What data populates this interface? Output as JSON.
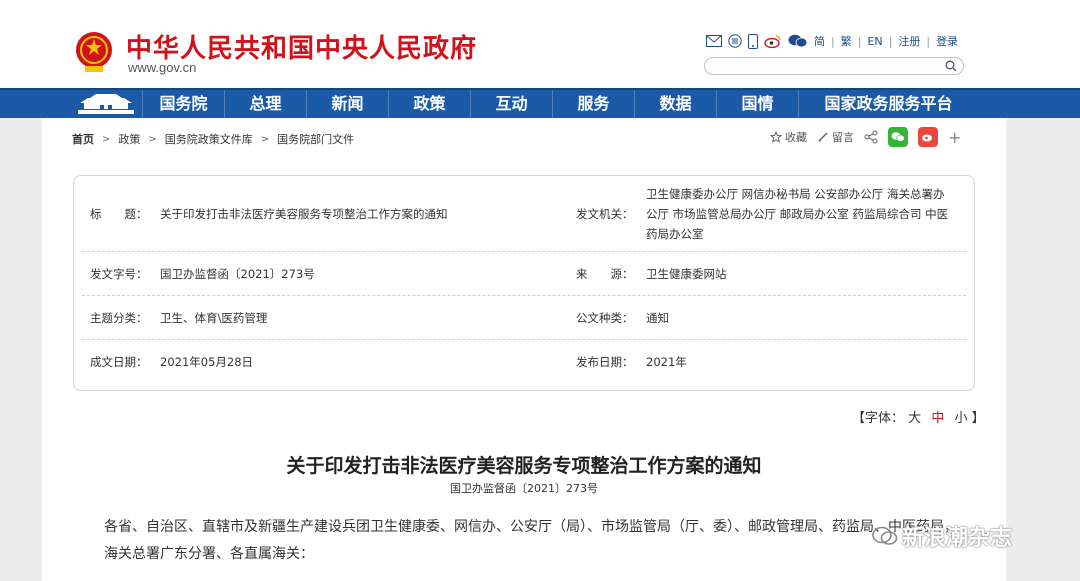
{
  "header": {
    "site_title": "中华人民共和国中央人民政府",
    "site_domain": "www.gov.cn",
    "util_links": [
      "简",
      "繁",
      "EN",
      "注册",
      "登录"
    ],
    "util_icons": [
      "mail-icon",
      "reader-icon",
      "mobile-icon",
      "weibo-icon",
      "wechat-icon"
    ]
  },
  "nav": {
    "items": [
      "国务院",
      "总理",
      "新闻",
      "政策",
      "互动",
      "服务",
      "数据",
      "国情"
    ],
    "platform": "国家政务服务平台"
  },
  "breadcrumb": [
    "首页",
    "政策",
    "国务院政策文件库",
    "国务院部门文件"
  ],
  "tools": {
    "favorite": "收藏",
    "message": "留言"
  },
  "info": {
    "title_label": "标　　题：",
    "title_value": "关于印发打击非法医疗美容服务专项整治工作方案的通知",
    "issuer_label": "发文机关：",
    "issuer_value": "卫生健康委办公厅  网信办秘书局  公安部办公厅  海关总署办公厅  市场监管总局办公厅  邮政局办公室  药监局综合司  中医药局办公室",
    "docno_label": "发文字号：",
    "docno_value": "国卫办监督函〔2021〕273号",
    "source_label": "来　　源：",
    "source_value": "卫生健康委网站",
    "topic_label": "主题分类：",
    "topic_value": "卫生、体育\\医药管理",
    "type_label": "公文种类：",
    "type_value": "通知",
    "created_label": "成文日期：",
    "created_value": "2021年05月28日",
    "published_label": "发布日期：",
    "published_value": "2021年"
  },
  "fontsize": {
    "prefix": "【字体：",
    "large": "大",
    "medium": "中",
    "small": "小",
    "suffix": "】"
  },
  "document": {
    "title": "关于印发打击非法医疗美容服务专项整治工作方案的通知",
    "number": "国卫办监督函〔2021〕273号",
    "body": "各省、自治区、直辖市及新疆生产建设兵团卫生健康委、网信办、公安厅（局）、市场监管局（厅、委）、邮政管理局、药监局、中医药局，海关总署广东分署、各直属海关："
  },
  "watermark": "新浪潮杂志",
  "colors": {
    "brand_red": "#d0121b",
    "nav_blue": "#1a5aa6",
    "link_blue": "#1f4c8f"
  }
}
